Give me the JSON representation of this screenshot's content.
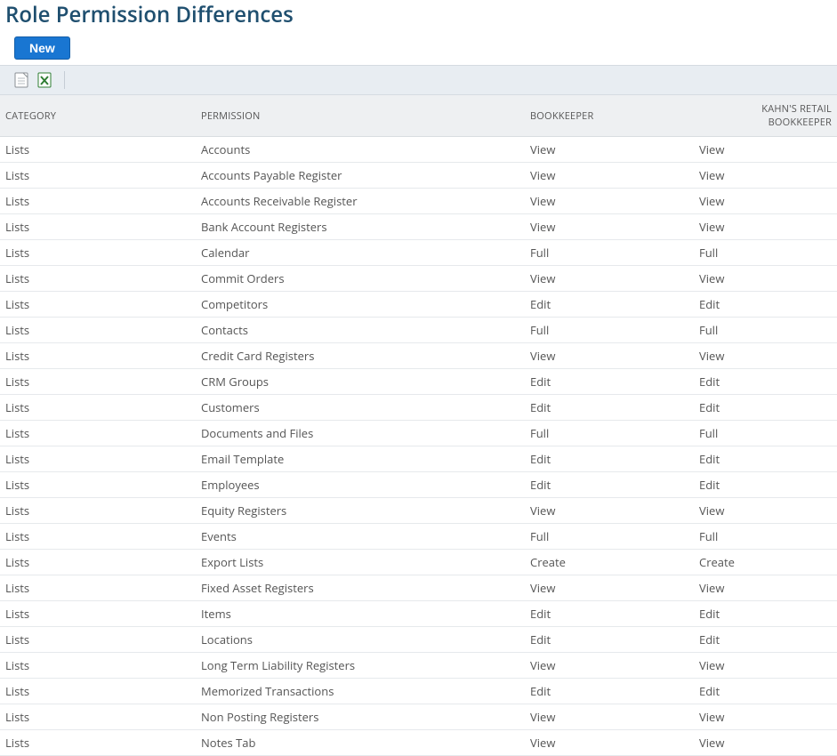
{
  "page": {
    "title": "Role Permission Differences"
  },
  "toolbar": {
    "new_button": "New"
  },
  "table": {
    "columns": {
      "category": "CATEGORY",
      "permission": "PERMISSION",
      "role1": "BOOKKEEPER",
      "role2": "KAHN'S RETAIL BOOKKEEPER"
    },
    "rows": [
      {
        "category": "Lists",
        "permission": "Accounts",
        "role1": "View",
        "role2": "View"
      },
      {
        "category": "Lists",
        "permission": "Accounts Payable Register",
        "role1": "View",
        "role2": "View"
      },
      {
        "category": "Lists",
        "permission": "Accounts Receivable Register",
        "role1": "View",
        "role2": "View"
      },
      {
        "category": "Lists",
        "permission": "Bank Account Registers",
        "role1": "View",
        "role2": "View"
      },
      {
        "category": "Lists",
        "permission": "Calendar",
        "role1": "Full",
        "role2": "Full"
      },
      {
        "category": "Lists",
        "permission": "Commit Orders",
        "role1": "View",
        "role2": "View"
      },
      {
        "category": "Lists",
        "permission": "Competitors",
        "role1": "Edit",
        "role2": "Edit"
      },
      {
        "category": "Lists",
        "permission": "Contacts",
        "role1": "Full",
        "role2": "Full"
      },
      {
        "category": "Lists",
        "permission": "Credit Card Registers",
        "role1": "View",
        "role2": "View"
      },
      {
        "category": "Lists",
        "permission": "CRM Groups",
        "role1": "Edit",
        "role2": "Edit"
      },
      {
        "category": "Lists",
        "permission": "Customers",
        "role1": "Edit",
        "role2": "Edit"
      },
      {
        "category": "Lists",
        "permission": "Documents and Files",
        "role1": "Full",
        "role2": "Full"
      },
      {
        "category": "Lists",
        "permission": "Email Template",
        "role1": "Edit",
        "role2": "Edit"
      },
      {
        "category": "Lists",
        "permission": "Employees",
        "role1": "Edit",
        "role2": "Edit"
      },
      {
        "category": "Lists",
        "permission": "Equity Registers",
        "role1": "View",
        "role2": "View"
      },
      {
        "category": "Lists",
        "permission": "Events",
        "role1": "Full",
        "role2": "Full"
      },
      {
        "category": "Lists",
        "permission": "Export Lists",
        "role1": "Create",
        "role2": "Create"
      },
      {
        "category": "Lists",
        "permission": "Fixed Asset Registers",
        "role1": "View",
        "role2": "View"
      },
      {
        "category": "Lists",
        "permission": "Items",
        "role1": "Edit",
        "role2": "Edit"
      },
      {
        "category": "Lists",
        "permission": "Locations",
        "role1": "Edit",
        "role2": "Edit"
      },
      {
        "category": "Lists",
        "permission": "Long Term Liability Registers",
        "role1": "View",
        "role2": "View"
      },
      {
        "category": "Lists",
        "permission": "Memorized Transactions",
        "role1": "Edit",
        "role2": "Edit"
      },
      {
        "category": "Lists",
        "permission": "Non Posting Registers",
        "role1": "View",
        "role2": "View"
      },
      {
        "category": "Lists",
        "permission": "Notes Tab",
        "role1": "View",
        "role2": "View"
      }
    ]
  }
}
